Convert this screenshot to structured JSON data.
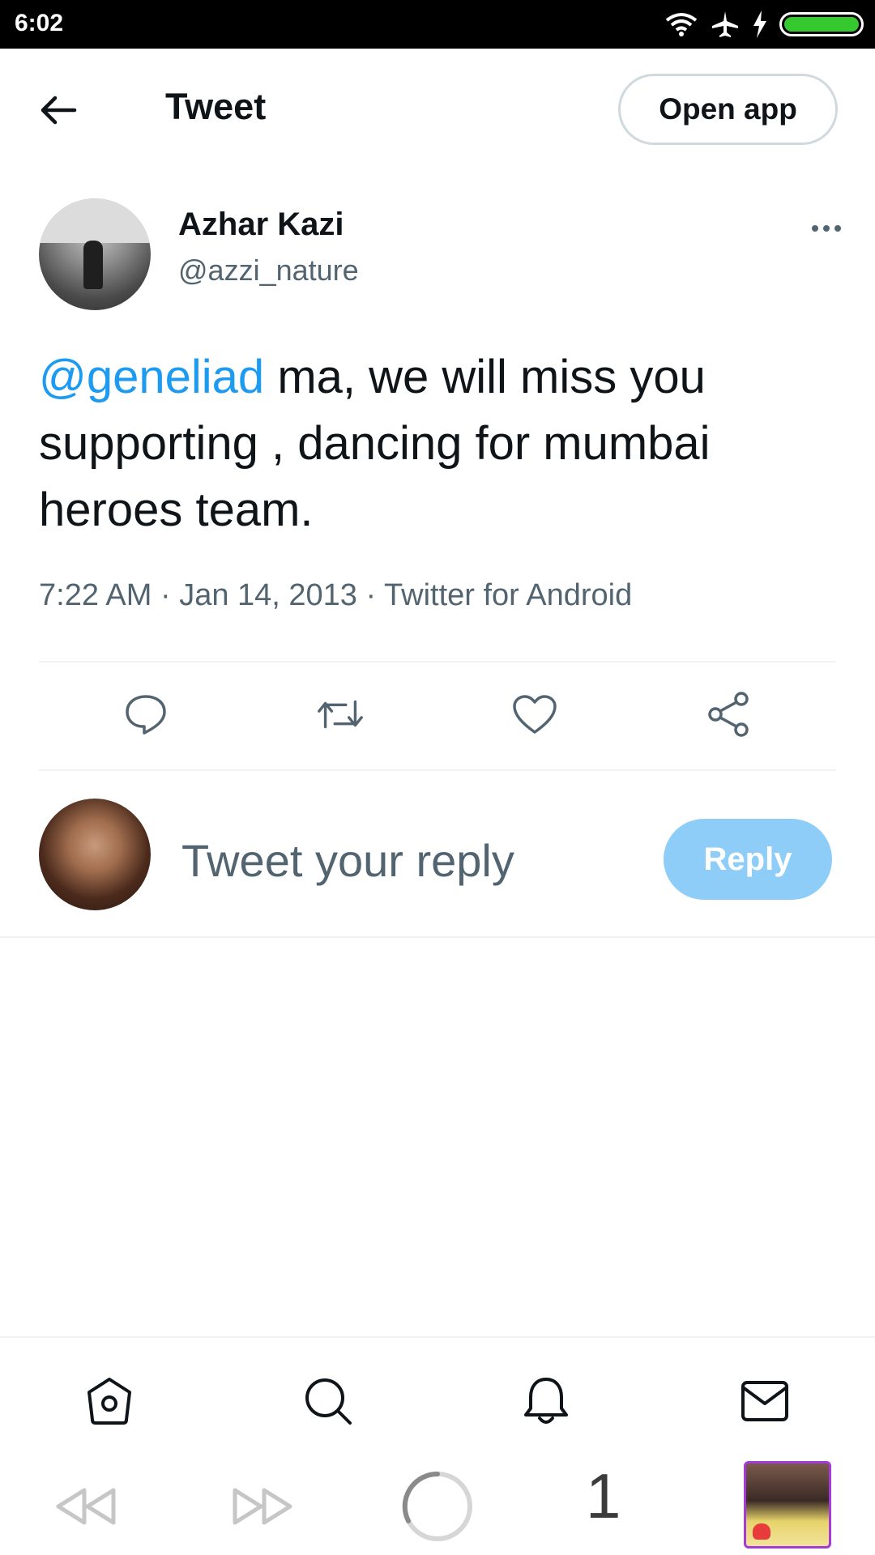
{
  "status_bar": {
    "time": "6:02"
  },
  "header": {
    "title": "Tweet",
    "open_app_label": "Open app"
  },
  "tweet": {
    "author_name": "Azhar Kazi",
    "author_handle": "@azzi_nature",
    "mention": "@geneliad",
    "text_rest": " ma, we will miss you supporting , dancing for mumbai heroes team.",
    "meta": "7:22 AM · Jan 14, 2013 · Twitter for Android"
  },
  "reply": {
    "placeholder": "Tweet your reply",
    "button_label": "Reply"
  },
  "browser": {
    "tab_count": "1"
  },
  "colors": {
    "accent": "#1d9bf0",
    "reply_button_disabled": "#8ecdf8",
    "secondary_text": "#536471"
  }
}
